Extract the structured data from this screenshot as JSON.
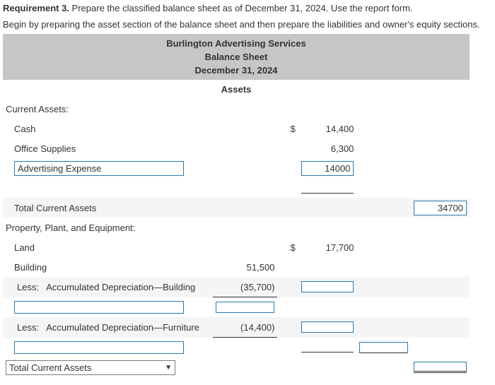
{
  "requirement": {
    "label": "Requirement 3.",
    "text": "Prepare the classified balance sheet as of December 31, 2024. Use the report form."
  },
  "instruction": "Begin by preparing the asset section of the balance sheet and then prepare the liabilities and owner's equity sections.",
  "header": {
    "company": "Burlington Advertising Services",
    "report": "Balance Sheet",
    "date": "December 31, 2024"
  },
  "sections": {
    "assets_heading": "Assets",
    "current_assets_label": "Current Assets:",
    "cash_label": "Cash",
    "cash_currency": "$",
    "cash_value": "14,400",
    "office_supplies_label": "Office Supplies",
    "office_supplies_value": "6,300",
    "adv_exp_input": "Advertising Expense",
    "adv_exp_value": "14000",
    "total_current_assets_label": "Total Current Assets",
    "total_current_assets_value": "34700",
    "ppe_label": "Property, Plant, and Equipment:",
    "land_label": "Land",
    "land_currency": "$",
    "land_value": "17,700",
    "building_label": "Building",
    "building_value": "51,500",
    "less_label_1": "Less:",
    "accum_dep_building_label": "Accumulated Depreciation—Building",
    "accum_dep_building_value": "(35,700)",
    "less_label_2": "Less:",
    "accum_dep_furniture_label": "Accumulated Depreciation—Furniture",
    "accum_dep_furniture_value": "(14,400)",
    "total_select_value": "Total Current Assets"
  }
}
